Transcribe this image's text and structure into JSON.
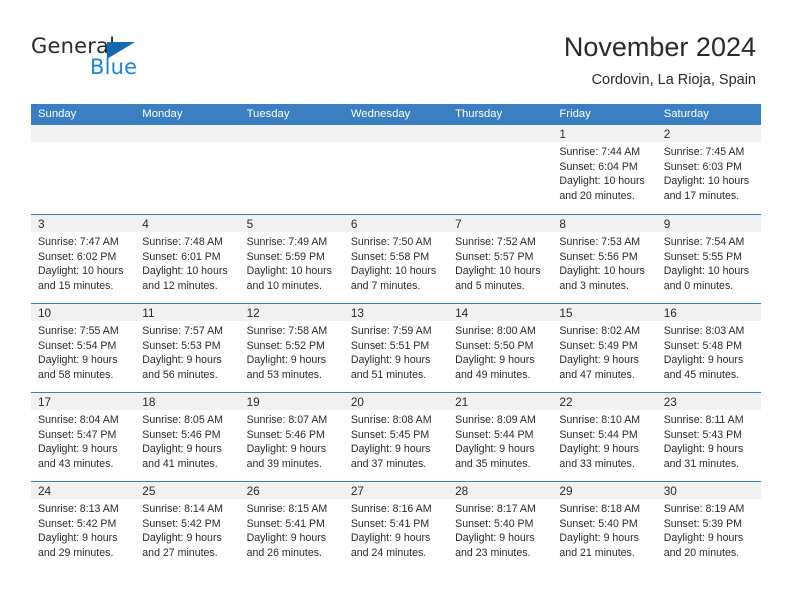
{
  "brand": {
    "name_primary": "General",
    "name_secondary": "Blue",
    "triangle_color": "#1469b5"
  },
  "header": {
    "title": "November 2024",
    "subtitle": "Cordovin, La Rioja, Spain"
  },
  "theme": {
    "header_blue": "#3a7fc1",
    "day_band_gray": "#f1f1f1",
    "text_color": "#2a2a2a"
  },
  "weekdays": [
    "Sunday",
    "Monday",
    "Tuesday",
    "Wednesday",
    "Thursday",
    "Friday",
    "Saturday"
  ],
  "weeks": [
    [
      {
        "day": "",
        "lines": []
      },
      {
        "day": "",
        "lines": []
      },
      {
        "day": "",
        "lines": []
      },
      {
        "day": "",
        "lines": []
      },
      {
        "day": "",
        "lines": []
      },
      {
        "day": "1",
        "lines": [
          "Sunrise: 7:44 AM",
          "Sunset: 6:04 PM",
          "Daylight: 10 hours",
          "and 20 minutes."
        ]
      },
      {
        "day": "2",
        "lines": [
          "Sunrise: 7:45 AM",
          "Sunset: 6:03 PM",
          "Daylight: 10 hours",
          "and 17 minutes."
        ]
      }
    ],
    [
      {
        "day": "3",
        "lines": [
          "Sunrise: 7:47 AM",
          "Sunset: 6:02 PM",
          "Daylight: 10 hours",
          "and 15 minutes."
        ]
      },
      {
        "day": "4",
        "lines": [
          "Sunrise: 7:48 AM",
          "Sunset: 6:01 PM",
          "Daylight: 10 hours",
          "and 12 minutes."
        ]
      },
      {
        "day": "5",
        "lines": [
          "Sunrise: 7:49 AM",
          "Sunset: 5:59 PM",
          "Daylight: 10 hours",
          "and 10 minutes."
        ]
      },
      {
        "day": "6",
        "lines": [
          "Sunrise: 7:50 AM",
          "Sunset: 5:58 PM",
          "Daylight: 10 hours",
          "and 7 minutes."
        ]
      },
      {
        "day": "7",
        "lines": [
          "Sunrise: 7:52 AM",
          "Sunset: 5:57 PM",
          "Daylight: 10 hours",
          "and 5 minutes."
        ]
      },
      {
        "day": "8",
        "lines": [
          "Sunrise: 7:53 AM",
          "Sunset: 5:56 PM",
          "Daylight: 10 hours",
          "and 3 minutes."
        ]
      },
      {
        "day": "9",
        "lines": [
          "Sunrise: 7:54 AM",
          "Sunset: 5:55 PM",
          "Daylight: 10 hours",
          "and 0 minutes."
        ]
      }
    ],
    [
      {
        "day": "10",
        "lines": [
          "Sunrise: 7:55 AM",
          "Sunset: 5:54 PM",
          "Daylight: 9 hours",
          "and 58 minutes."
        ]
      },
      {
        "day": "11",
        "lines": [
          "Sunrise: 7:57 AM",
          "Sunset: 5:53 PM",
          "Daylight: 9 hours",
          "and 56 minutes."
        ]
      },
      {
        "day": "12",
        "lines": [
          "Sunrise: 7:58 AM",
          "Sunset: 5:52 PM",
          "Daylight: 9 hours",
          "and 53 minutes."
        ]
      },
      {
        "day": "13",
        "lines": [
          "Sunrise: 7:59 AM",
          "Sunset: 5:51 PM",
          "Daylight: 9 hours",
          "and 51 minutes."
        ]
      },
      {
        "day": "14",
        "lines": [
          "Sunrise: 8:00 AM",
          "Sunset: 5:50 PM",
          "Daylight: 9 hours",
          "and 49 minutes."
        ]
      },
      {
        "day": "15",
        "lines": [
          "Sunrise: 8:02 AM",
          "Sunset: 5:49 PM",
          "Daylight: 9 hours",
          "and 47 minutes."
        ]
      },
      {
        "day": "16",
        "lines": [
          "Sunrise: 8:03 AM",
          "Sunset: 5:48 PM",
          "Daylight: 9 hours",
          "and 45 minutes."
        ]
      }
    ],
    [
      {
        "day": "17",
        "lines": [
          "Sunrise: 8:04 AM",
          "Sunset: 5:47 PM",
          "Daylight: 9 hours",
          "and 43 minutes."
        ]
      },
      {
        "day": "18",
        "lines": [
          "Sunrise: 8:05 AM",
          "Sunset: 5:46 PM",
          "Daylight: 9 hours",
          "and 41 minutes."
        ]
      },
      {
        "day": "19",
        "lines": [
          "Sunrise: 8:07 AM",
          "Sunset: 5:46 PM",
          "Daylight: 9 hours",
          "and 39 minutes."
        ]
      },
      {
        "day": "20",
        "lines": [
          "Sunrise: 8:08 AM",
          "Sunset: 5:45 PM",
          "Daylight: 9 hours",
          "and 37 minutes."
        ]
      },
      {
        "day": "21",
        "lines": [
          "Sunrise: 8:09 AM",
          "Sunset: 5:44 PM",
          "Daylight: 9 hours",
          "and 35 minutes."
        ]
      },
      {
        "day": "22",
        "lines": [
          "Sunrise: 8:10 AM",
          "Sunset: 5:44 PM",
          "Daylight: 9 hours",
          "and 33 minutes."
        ]
      },
      {
        "day": "23",
        "lines": [
          "Sunrise: 8:11 AM",
          "Sunset: 5:43 PM",
          "Daylight: 9 hours",
          "and 31 minutes."
        ]
      }
    ],
    [
      {
        "day": "24",
        "lines": [
          "Sunrise: 8:13 AM",
          "Sunset: 5:42 PM",
          "Daylight: 9 hours",
          "and 29 minutes."
        ]
      },
      {
        "day": "25",
        "lines": [
          "Sunrise: 8:14 AM",
          "Sunset: 5:42 PM",
          "Daylight: 9 hours",
          "and 27 minutes."
        ]
      },
      {
        "day": "26",
        "lines": [
          "Sunrise: 8:15 AM",
          "Sunset: 5:41 PM",
          "Daylight: 9 hours",
          "and 26 minutes."
        ]
      },
      {
        "day": "27",
        "lines": [
          "Sunrise: 8:16 AM",
          "Sunset: 5:41 PM",
          "Daylight: 9 hours",
          "and 24 minutes."
        ]
      },
      {
        "day": "28",
        "lines": [
          "Sunrise: 8:17 AM",
          "Sunset: 5:40 PM",
          "Daylight: 9 hours",
          "and 23 minutes."
        ]
      },
      {
        "day": "29",
        "lines": [
          "Sunrise: 8:18 AM",
          "Sunset: 5:40 PM",
          "Daylight: 9 hours",
          "and 21 minutes."
        ]
      },
      {
        "day": "30",
        "lines": [
          "Sunrise: 8:19 AM",
          "Sunset: 5:39 PM",
          "Daylight: 9 hours",
          "and 20 minutes."
        ]
      }
    ]
  ]
}
